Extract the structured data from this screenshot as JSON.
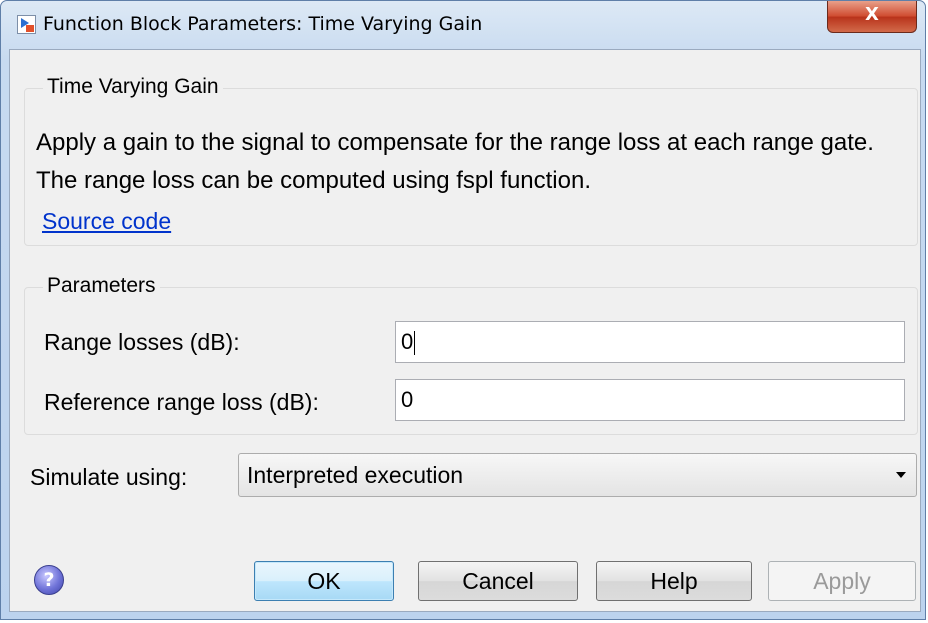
{
  "window": {
    "title": "Function Block Parameters: Time Varying Gain",
    "close_glyph": "X"
  },
  "block_group": {
    "title": "Time Varying Gain",
    "description": "Apply a gain to the signal to compensate for the range loss at each range gate. The range loss can be computed using fspl function.",
    "source_link": "Source code"
  },
  "parameters_group": {
    "title": "Parameters",
    "range_losses": {
      "label": "Range losses (dB):",
      "value": "0"
    },
    "reference_range_loss": {
      "label": "Reference range loss (dB):",
      "value": "0"
    }
  },
  "simulate": {
    "label": "Simulate using:",
    "selected": "Interpreted execution"
  },
  "buttons": {
    "ok": "OK",
    "cancel": "Cancel",
    "help": "Help",
    "apply": "Apply"
  },
  "icons": {
    "app": "simulink-block-icon",
    "help": "help-question-icon"
  },
  "colors": {
    "link": "#0033cc",
    "close_button": "#cf4a2e",
    "default_button_border": "#3c7fb1"
  }
}
